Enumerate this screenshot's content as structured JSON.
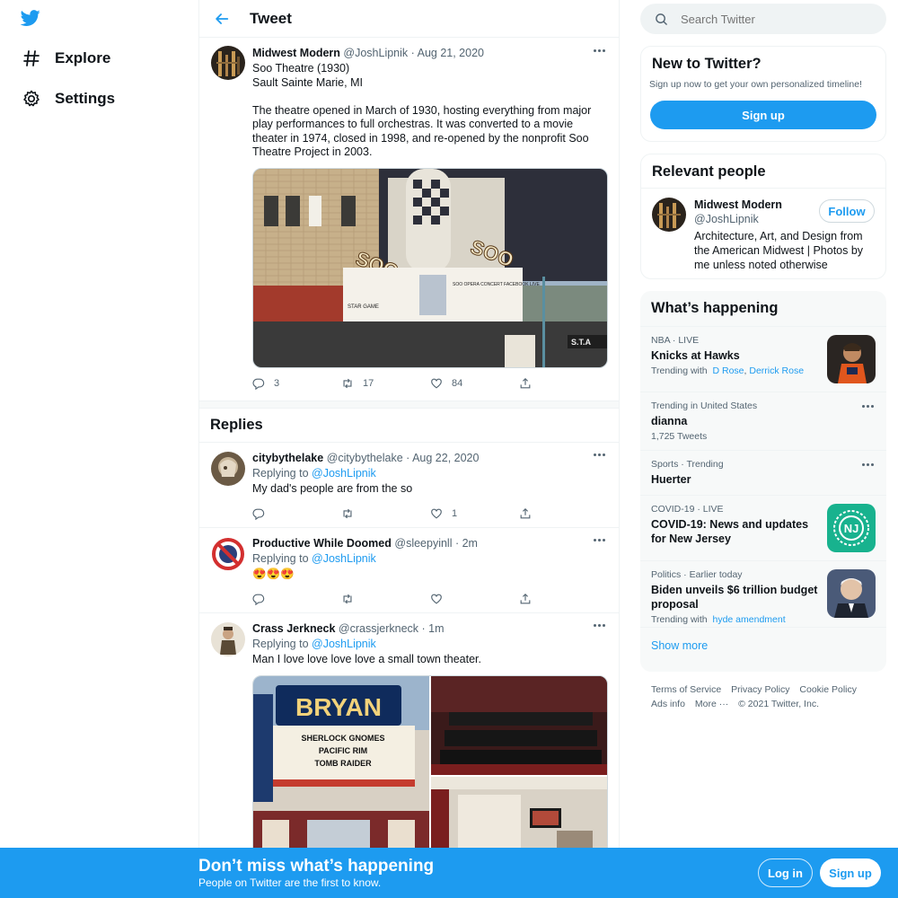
{
  "nav": {
    "items": [
      {
        "label": "Explore",
        "icon": "hash-icon"
      },
      {
        "label": "Settings",
        "icon": "gear-icon"
      }
    ]
  },
  "header": {
    "title": "Tweet"
  },
  "main_tweet": {
    "name": "Midwest Modern",
    "handle": "@JoshLipnik",
    "date": "· Aug 21, 2020",
    "line1": "Soo Theatre (1930)",
    "line2": "Sault Sainte Marie, MI",
    "paragraph": "The theatre opened in March of 1930, hosting everything from major play performances to full orchestras. It was converted to a movie theater in 1974, closed in 1998, and re-opened by the nonprofit Soo Theatre Project in 2003.",
    "image_signs": {
      "left": "SOO",
      "right": "SOO",
      "marquee_left": "STAR GAME",
      "marquee_right": "SOO OPERA CONCERT FACEBOOK LIVE",
      "store": "S.T.A"
    },
    "replies": "3",
    "retweets": "17",
    "likes": "84"
  },
  "replies_header": "Replies",
  "replies": [
    {
      "name": "citybythelake",
      "handle": "@citybythelake",
      "date": "· Aug 22, 2020",
      "replying_prefix": "Replying to",
      "replying_to": "@JoshLipnik",
      "text": "My dad's people are from the so",
      "likes": "1"
    },
    {
      "name": "Productive While Doomed",
      "handle": "@sleepyinll",
      "date": "· 2m",
      "replying_prefix": "Replying to",
      "replying_to": "@JoshLipnik",
      "text": "😍😍😍",
      "likes": ""
    },
    {
      "name": "Crass Jerkneck",
      "handle": "@crassjerkneck",
      "date": "· 1m",
      "replying_prefix": "Replying to",
      "replying_to": "@JoshLipnik",
      "text": "Man I love love love love a small town theater.",
      "image_sign": "BRYAN",
      "image_marquee": [
        "SHERLOCK GNOMES",
        "PACIFIC RIM",
        "TOMB RAIDER"
      ]
    }
  ],
  "search": {
    "placeholder": "Search Twitter"
  },
  "new_to_twitter": {
    "title": "New to Twitter?",
    "sub": "Sign up now to get your own personalized timeline!",
    "button": "Sign up"
  },
  "relevant": {
    "title": "Relevant people",
    "name": "Midwest Modern",
    "handle": "@JoshLipnik",
    "follow": "Follow",
    "bio": "Architecture, Art, and Design from the American Midwest | Photos by me unless noted otherwise"
  },
  "happening": {
    "title": "What’s happening",
    "trends": [
      {
        "context": "NBA · LIVE",
        "title": "Knicks at Hawks",
        "sub_prefix": "Trending with",
        "links": [
          "D Rose",
          "Derrick Rose"
        ],
        "thumb": "basketball"
      },
      {
        "context": "Trending in United States",
        "title": "dianna",
        "sub": "1,725 Tweets"
      },
      {
        "context": "Sports · Trending",
        "title": "Huerter"
      },
      {
        "context": "COVID-19 · LIVE",
        "title": "COVID-19: News and updates for New Jersey",
        "thumb": "nj",
        "thumb_text": "NJ"
      },
      {
        "context": "Politics · Earlier today",
        "title": "Biden unveils $6 trillion budget proposal",
        "sub_prefix": "Trending with",
        "links": [
          "hyde amendment"
        ],
        "thumb": "person"
      }
    ],
    "show_more": "Show more"
  },
  "footer": {
    "links": [
      "Terms of Service",
      "Privacy Policy",
      "Cookie Policy",
      "Ads info",
      "More ···",
      "© 2021 Twitter, Inc."
    ]
  },
  "banner": {
    "title": "Don’t miss what’s happening",
    "sub": "People on Twitter are the first to know.",
    "login": "Log in",
    "signup": "Sign up"
  },
  "colors": {
    "accent": "#1d9bf0",
    "text": "#0f1419",
    "muted": "#536471"
  }
}
